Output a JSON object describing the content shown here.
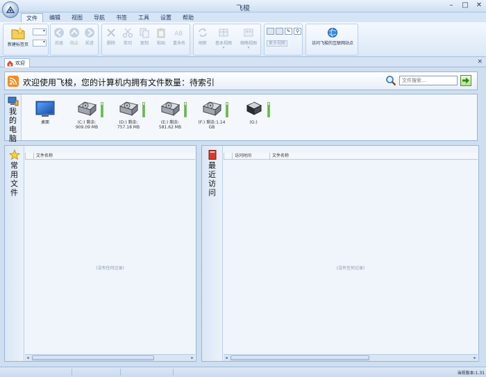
{
  "window": {
    "title": "飞梭",
    "min_glyph": "–",
    "max_glyph": "□",
    "close_glyph": "✕"
  },
  "menu": {
    "tabs": [
      "文件",
      "编辑",
      "视图",
      "导航",
      "书签",
      "工具",
      "设置",
      "帮助"
    ],
    "active_index": 0
  },
  "ribbon": {
    "new_tab": "新建标签页",
    "back": "后退",
    "up": "向上",
    "forward": "前进",
    "delete": "删除",
    "cut": "剪切",
    "copy": "复制",
    "paste": "粘贴",
    "rename": "重命名",
    "refresh": "刷新",
    "basic_view": "基本视图",
    "thumb_view": "缩略视图",
    "more_view": "更多视图",
    "visit_site": "访问飞梭的互联网站点"
  },
  "doc_tab": {
    "label": "欢迎",
    "close_glyph": "×"
  },
  "banner": {
    "text": "欢迎使用飞梭，您的计算机内拥有文件数量：待索引",
    "search_placeholder": "文件搜索..."
  },
  "computer": {
    "label_chars": [
      "我",
      "的",
      "电",
      "脑"
    ],
    "desktop_label": "桌面",
    "drives": [
      {
        "label_line1": "(C:) 剩余:",
        "label_line2": "909.09 MB",
        "fill": 0.85,
        "type": "hdd"
      },
      {
        "label_line1": "(D:) 剩余:",
        "label_line2": "757.18 MB",
        "fill": 0.85,
        "type": "hdd"
      },
      {
        "label_line1": "(E:) 剩余:",
        "label_line2": "581.62 MB",
        "fill": 0.85,
        "type": "hdd"
      },
      {
        "label_line1": "(F:) 剩余:1.14",
        "label_line2": "GB",
        "fill": 0.85,
        "type": "hdd"
      },
      {
        "label_line1": "(G:)",
        "label_line2": "",
        "fill": 0.85,
        "type": "floppy"
      }
    ]
  },
  "common_files": {
    "label_chars": [
      "常",
      "用",
      "文",
      "件"
    ],
    "col_name": "文件名称",
    "empty": "(没有任何记录)"
  },
  "recent": {
    "label_chars": [
      "最",
      "近",
      "访",
      "问"
    ],
    "col_time": "访问时间",
    "col_name": "文件名称",
    "empty": "(没有任何记录)"
  },
  "status": {
    "version": "当前版本:1.31"
  },
  "colors": {
    "accent": "#3b6fb6",
    "rss": "#f58b1f",
    "usage_bar": "#57c53a"
  }
}
